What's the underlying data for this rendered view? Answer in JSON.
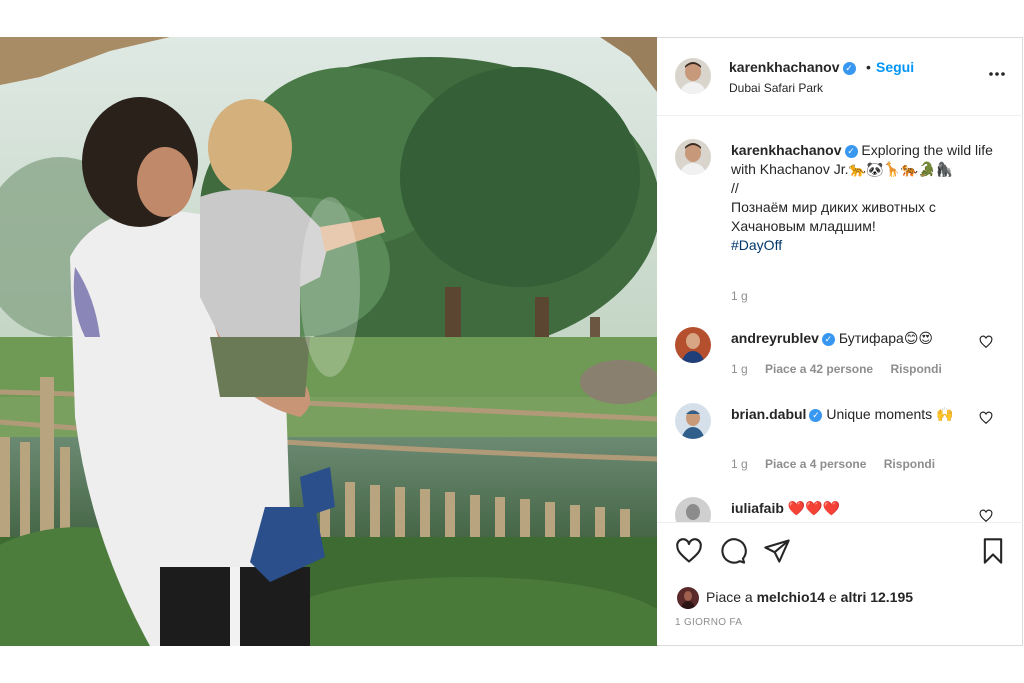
{
  "header": {
    "username": "karenkhachanov",
    "verified_mark": "✓",
    "separator": "•",
    "follow_label": "Segui",
    "location": "Dubai Safari Park",
    "more_icon": "more-horizontal-icon"
  },
  "caption": {
    "username": "karenkhachanov",
    "text": "Exploring the wild life with Khachanov Jr.🐆🐼🦒🐅🐊🦍",
    "separator": "//",
    "text_ru": "Познаём мир диких животных с Хачановым младшим!",
    "hashtag": "#DayOff",
    "time": "1 g"
  },
  "comments": [
    {
      "username": "andreyrublev",
      "text": "Бутифара😊😍",
      "time": "1 g",
      "likes": "Piace a 42 persone",
      "reply": "Rispondi",
      "avatar_color": "#b5502e"
    },
    {
      "username": "brian.dabul",
      "text": "Unique moments 🙌",
      "time": "1 g",
      "likes": "Piace a 4 persone",
      "reply": "Rispondi",
      "avatar_color": "#2f5f8a"
    },
    {
      "username": "iuliafaib",
      "text": "❤️❤️❤️",
      "avatar_color": "#8c8c8c"
    }
  ],
  "actions": {
    "like_icon": "heart-icon",
    "comment_icon": "comment-icon",
    "share_icon": "share-icon",
    "save_icon": "bookmark-icon"
  },
  "likes": {
    "prefix": "Piace a",
    "user": "melchio14",
    "middle": "e",
    "others": "altri 12.195"
  },
  "posted": "1 GIORNO FA",
  "colors": {
    "accent": "#0095f6",
    "verified": "#3897f0",
    "muted": "#8e8e8e",
    "border": "#dbdbdb"
  }
}
